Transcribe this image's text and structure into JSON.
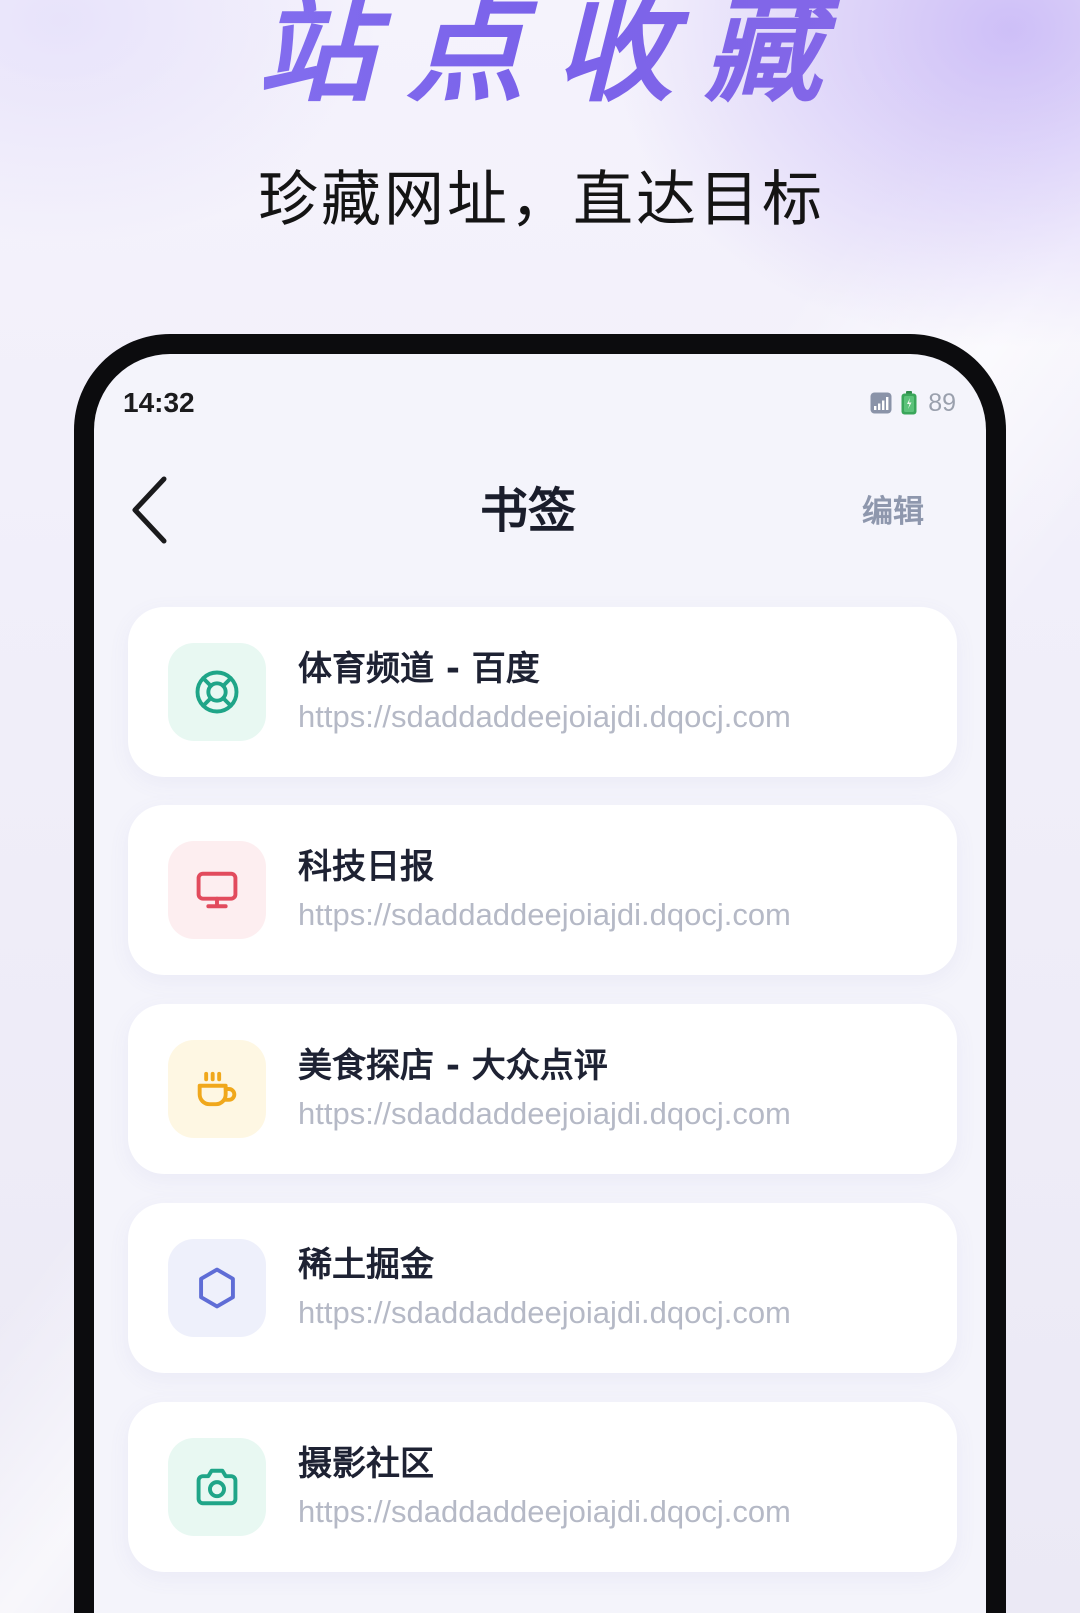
{
  "hero": {
    "title": "站点收藏",
    "subtitle": "珍藏网址，直达目标"
  },
  "status_bar": {
    "time": "14:32",
    "battery_level": "89",
    "signal_icon": "signal-icon",
    "battery_icon": "battery-icon"
  },
  "nav": {
    "back_icon": "chevron-left-icon",
    "title": "书签",
    "edit_label": "编辑"
  },
  "bookmarks": [
    {
      "title": "体育频道 - 百度",
      "url": "https://sdaddaddeejoiajdi.dqocj.com",
      "icon": "lifebuoy-icon",
      "icon_color": "#1fa588",
      "icon_bg": "#e8f8f2"
    },
    {
      "title": "科技日报",
      "url": "https://sdaddaddeejoiajdi.dqocj.com",
      "icon": "monitor-icon",
      "icon_color": "#e24b5d",
      "icon_bg": "#fdeef0"
    },
    {
      "title": "美食探店 - 大众点评",
      "url": "https://sdaddaddeejoiajdi.dqocj.com",
      "icon": "coffee-cup-icon",
      "icon_color": "#f0a81c",
      "icon_bg": "#fef7e3"
    },
    {
      "title": "稀土掘金",
      "url": "https://sdaddaddeejoiajdi.dqocj.com",
      "icon": "hexagon-icon",
      "icon_color": "#5f6dd6",
      "icon_bg": "#eef0fb"
    },
    {
      "title": "摄影社区",
      "url": "https://sdaddaddeejoiajdi.dqocj.com",
      "icon": "camera-icon",
      "icon_color": "#1fa588",
      "icon_bg": "#e8f8f2"
    }
  ],
  "colors": {
    "accent": "#7c67ec",
    "screen_bg": "#f4f4fb",
    "card_bg": "#ffffff",
    "title_text": "#1e2233",
    "url_text": "#b5b9c6",
    "edit_text": "#8e97ad",
    "battery_green": "#3aa65a"
  }
}
